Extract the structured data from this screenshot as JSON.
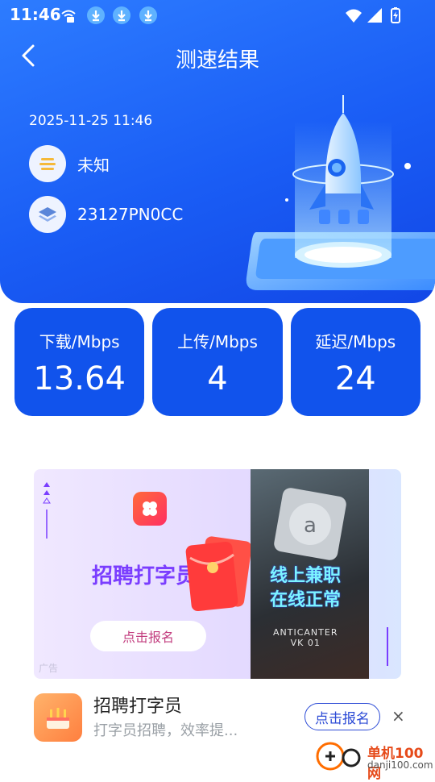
{
  "status_bar": {
    "time": "11:46",
    "icons": [
      "vpn-icon",
      "download-icon",
      "download-icon",
      "download-icon",
      "wifi-icon",
      "signal-icon",
      "battery-charging-icon"
    ]
  },
  "header": {
    "title": "测速结果",
    "back_icon": "chevron-left-icon"
  },
  "result": {
    "date": "2025-11-25 11:46",
    "network_name": "未知",
    "device_model": "23127PN0CC"
  },
  "metrics": [
    {
      "label": "下载/Mbps",
      "value": "13.64"
    },
    {
      "label": "上传/Mbps",
      "value": "4"
    },
    {
      "label": "延迟/Mbps",
      "value": "24"
    }
  ],
  "ad_banner": {
    "headline": "招聘打字员",
    "cta": "点击报名",
    "right_text_line1": "线上兼职",
    "right_text_line2": "在线正常",
    "right_small_line1": "ANTICANTER",
    "right_small_line2": "VK 01",
    "ad_mark": "广告"
  },
  "ad_app": {
    "name": "招聘打字员",
    "description": "打字员招聘，效率提...",
    "button": "点击报名",
    "close": "×"
  },
  "watermark": {
    "name": "单机100网",
    "url": "danji100.com"
  },
  "colors": {
    "hero_blue": "#1a5df5",
    "card_blue": "#1153ec",
    "button_outline": "#2c4bd6",
    "ad_purple": "#7a3dff"
  }
}
